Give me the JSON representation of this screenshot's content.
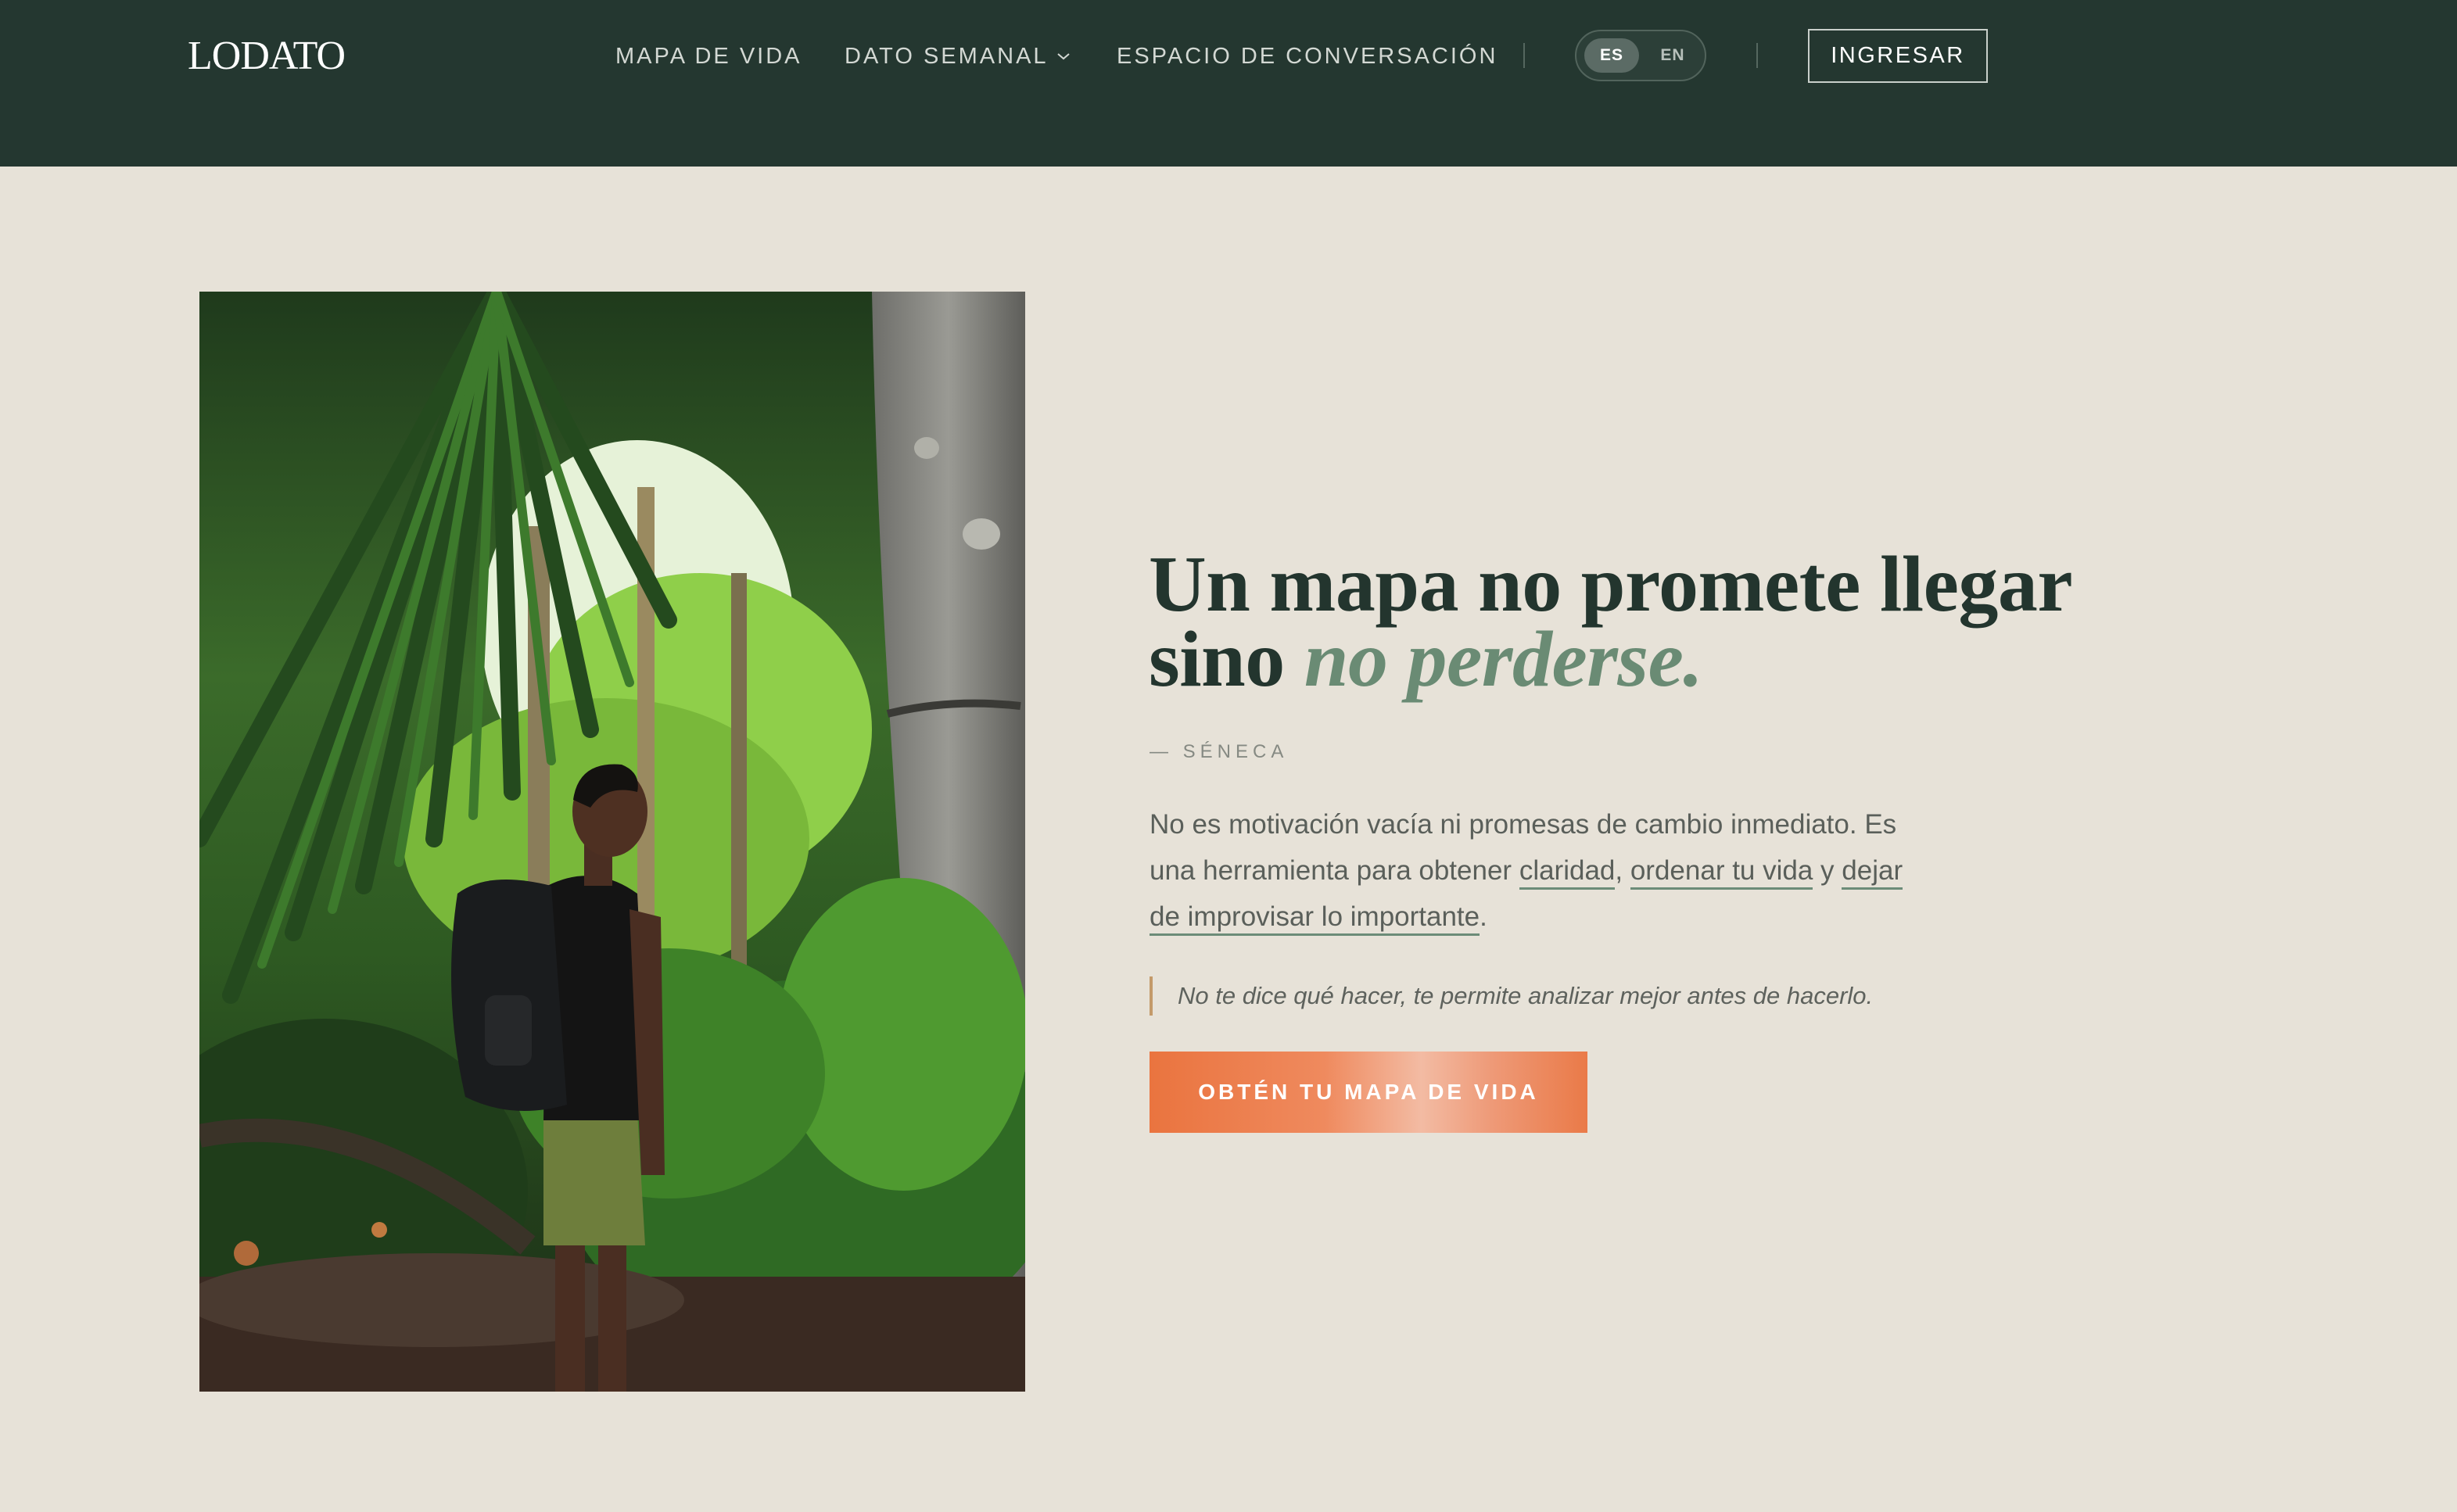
{
  "header": {
    "logo": "LODATO",
    "nav": [
      {
        "label": "MAPA DE VIDA"
      },
      {
        "label": "DATO SEMANAL"
      },
      {
        "label": "ESPACIO DE CONVERSACIÓN"
      }
    ],
    "language": {
      "options": [
        "ES",
        "EN"
      ],
      "selected": "ES"
    },
    "login_label": "INGRESAR"
  },
  "hero": {
    "headline_part1": "Un mapa no promete llegar sino ",
    "headline_accent": "no perderse.",
    "attribution": "— SÉNECA",
    "body": {
      "part1": "No es motivación vacía ni promesas de cambio inmediato. Es una herramienta para obtener ",
      "link1": "claridad",
      "sep1": ", ",
      "link2": "ordenar tu vida",
      "sep2": " y ",
      "link3": "dejar de improvisar lo importante",
      "end": "."
    },
    "quote": "No te dice qué hacer, te permite analizar mejor antes de hacerlo.",
    "cta_label": "OBTÉN TU MAPA DE VIDA"
  },
  "colors": {
    "header_bg": "#243730",
    "page_bg": "#e7e2d8",
    "headline": "#23352e",
    "accent_green": "#6a8b74",
    "cta_orange": "#ea743f",
    "quote_bar": "#c49a6a"
  }
}
